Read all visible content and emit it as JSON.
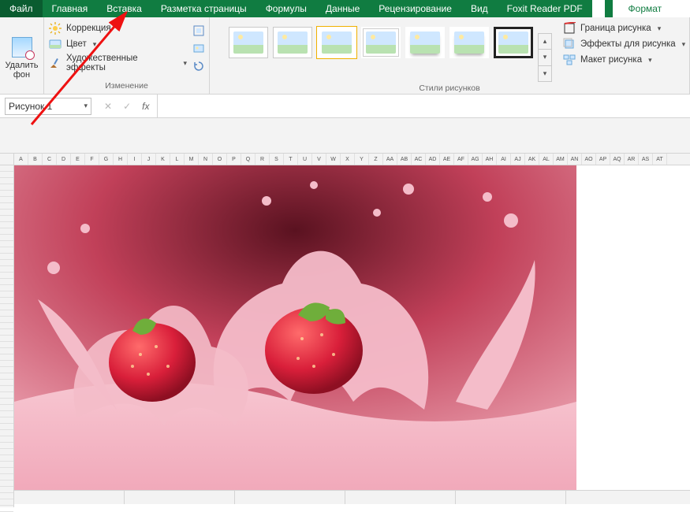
{
  "tabs": {
    "file": "Файл",
    "home": "Главная",
    "insert": "Вставка",
    "pagelayout": "Разметка страницы",
    "formulas": "Формулы",
    "data": "Данные",
    "review": "Рецензирование",
    "view": "Вид",
    "foxit": "Foxit Reader PDF",
    "format": "Формат"
  },
  "ribbon": {
    "removebg": "Удалить\nфон",
    "correction": "Коррекция",
    "color": "Цвет",
    "effects": "Художественные эффекты",
    "group_adjust": "Изменение",
    "group_styles": "Стили рисунков",
    "border": "Граница рисунка",
    "piceffects": "Эффекты для рисунка",
    "layout": "Макет рисунка"
  },
  "namebox": "Рисунок 1",
  "colheaders": [
    "A",
    "B",
    "C",
    "D",
    "E",
    "F",
    "G",
    "H",
    "I",
    "J",
    "K",
    "L",
    "M",
    "N",
    "O",
    "P",
    "Q",
    "R",
    "S",
    "T",
    "U",
    "V",
    "W",
    "X",
    "Y",
    "Z",
    "AA",
    "AB",
    "AC",
    "AD",
    "AE",
    "AF",
    "AG",
    "AH",
    "AI",
    "AJ",
    "AK",
    "AL",
    "AM",
    "AN",
    "AO",
    "AP",
    "AQ",
    "AR",
    "AS",
    "AT"
  ]
}
